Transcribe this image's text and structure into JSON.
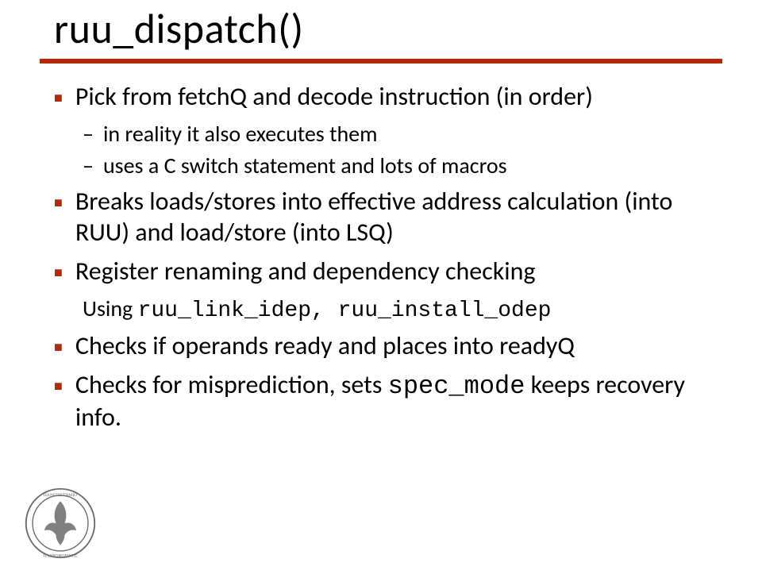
{
  "title": "ruu_dispatch()",
  "bullets": {
    "b1": {
      "text": "Pick from fetchQ and decode instruction (in order)",
      "sub": [
        "in reality it also executes them",
        "uses a C switch statement and lots of macros"
      ]
    },
    "b2": {
      "text": "Breaks loads/stores into effective address calculation (into RUU) and load/store (into LSQ)"
    },
    "b3": {
      "text": "Register renaming and dependency checking",
      "sub_prefix": "Using ",
      "sub_code": "ruu_link_idep, ruu_install_odep"
    },
    "b4": {
      "text": "Checks if operands ready and places into readyQ"
    },
    "b5": {
      "pre": "Checks for misprediction, sets ",
      "code": "spec_mode",
      "post": "  keeps recovery info."
    }
  }
}
